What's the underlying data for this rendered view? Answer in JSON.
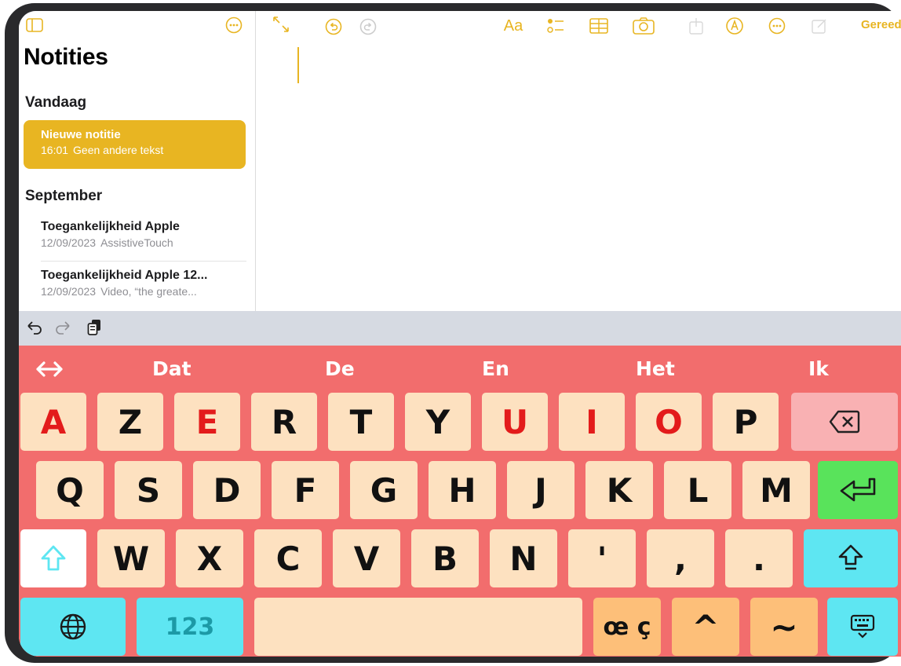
{
  "colors": {
    "accent": "#e8b522",
    "keyboard_background": "#f26d6d",
    "key_face": "#fde1c0",
    "vowel_text": "#e31b1b",
    "backspace_key": "#f9b1b3",
    "enter_key": "#59e35b",
    "function_key": "#5ee6f2",
    "accent_keys": "#fdbf79"
  },
  "sidebar": {
    "title": "Notities",
    "sections": [
      {
        "label": "Vandaag"
      },
      {
        "label": "September"
      }
    ],
    "notes": [
      {
        "title": "Nieuwe notitie",
        "time": "16:01",
        "preview": "Geen andere tekst",
        "selected": true
      },
      {
        "title": "Toegankelijkheid Apple",
        "time": "12/09/2023",
        "preview": "AssistiveTouch"
      },
      {
        "title": "Toegankelijkheid Apple 12...",
        "time": "12/09/2023",
        "preview": "Video, “the greate..."
      }
    ]
  },
  "toolbar": {
    "done_label": "Gereed",
    "format_label": "Aa",
    "icons": [
      "sidebar-toggle-icon",
      "more-options-icon",
      "expand-icon",
      "undo-icon",
      "redo-icon",
      "format-icon",
      "checklist-icon",
      "table-icon",
      "camera-icon",
      "share-icon",
      "markup-icon",
      "more-icon",
      "compose-icon"
    ]
  },
  "shortcut_bar": {
    "icons": [
      "undo-arrow-icon",
      "redo-arrow-icon",
      "paste-icon"
    ]
  },
  "keyboard": {
    "predictions": [
      "Dat",
      "De",
      "En",
      "Het",
      "Ik"
    ],
    "row1": [
      "A",
      "Z",
      "E",
      "R",
      "T",
      "Y",
      "U",
      "I",
      "O",
      "P"
    ],
    "row2": [
      "Q",
      "S",
      "D",
      "F",
      "G",
      "H",
      "J",
      "K",
      "L",
      "M"
    ],
    "row3": [
      "W",
      "X",
      "C",
      "V",
      "B",
      "N",
      "'",
      ",",
      "."
    ],
    "numbers_label": "123",
    "accents_label": "œ ç",
    "caret_label": "^",
    "tilde_label": "~",
    "vowels": [
      "A",
      "E",
      "U",
      "I",
      "O"
    ]
  }
}
